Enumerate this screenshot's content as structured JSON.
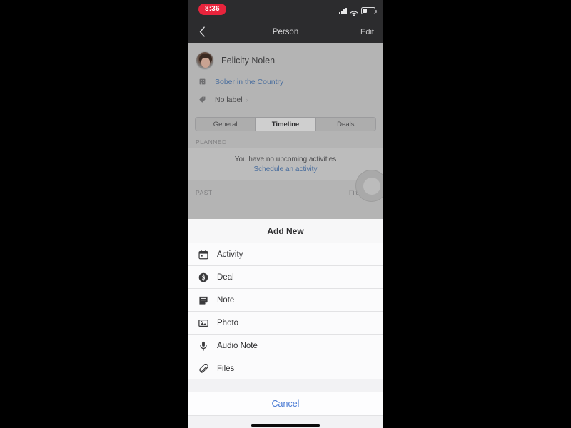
{
  "status_bar": {
    "time": "8:36",
    "signal_icon": "cellular-signal-icon",
    "wifi_icon": "wifi-icon",
    "battery_icon": "battery-icon",
    "battery_level_percent": 40,
    "recording_pill_color": "#e8243c"
  },
  "nav_bar": {
    "back_icon": "chevron-left-icon",
    "title": "Person",
    "edit_label": "Edit"
  },
  "person": {
    "avatar_name": "avatar",
    "name": "Felicity Nolen",
    "organization": {
      "icon": "organization-icon",
      "label": "Sober in the Country",
      "color": "#4a6e9e"
    },
    "label_field": {
      "icon": "tag-icon",
      "label": "No label",
      "chevron": "›"
    }
  },
  "segmented_control": {
    "options": [
      "General",
      "Timeline",
      "Deals"
    ],
    "selected": "Timeline"
  },
  "timeline": {
    "planned_header": "PLANNED",
    "empty_message": "You have no upcoming activities",
    "schedule_link": "Schedule an activity",
    "past_header": "PAST",
    "filter_label": "Filter",
    "filter_icon": "sliders-icon",
    "fab_icon": "add-fab-icon"
  },
  "action_sheet": {
    "title": "Add New",
    "items": [
      {
        "icon": "calendar-icon",
        "label": "Activity"
      },
      {
        "icon": "dollar-circle-icon",
        "label": "Deal"
      },
      {
        "icon": "note-icon",
        "label": "Note"
      },
      {
        "icon": "photo-icon",
        "label": "Photo"
      },
      {
        "icon": "microphone-icon",
        "label": "Audio Note"
      },
      {
        "icon": "paperclip-icon",
        "label": "Files"
      }
    ],
    "cancel_label": "Cancel",
    "cancel_color": "#4b7bd4"
  }
}
